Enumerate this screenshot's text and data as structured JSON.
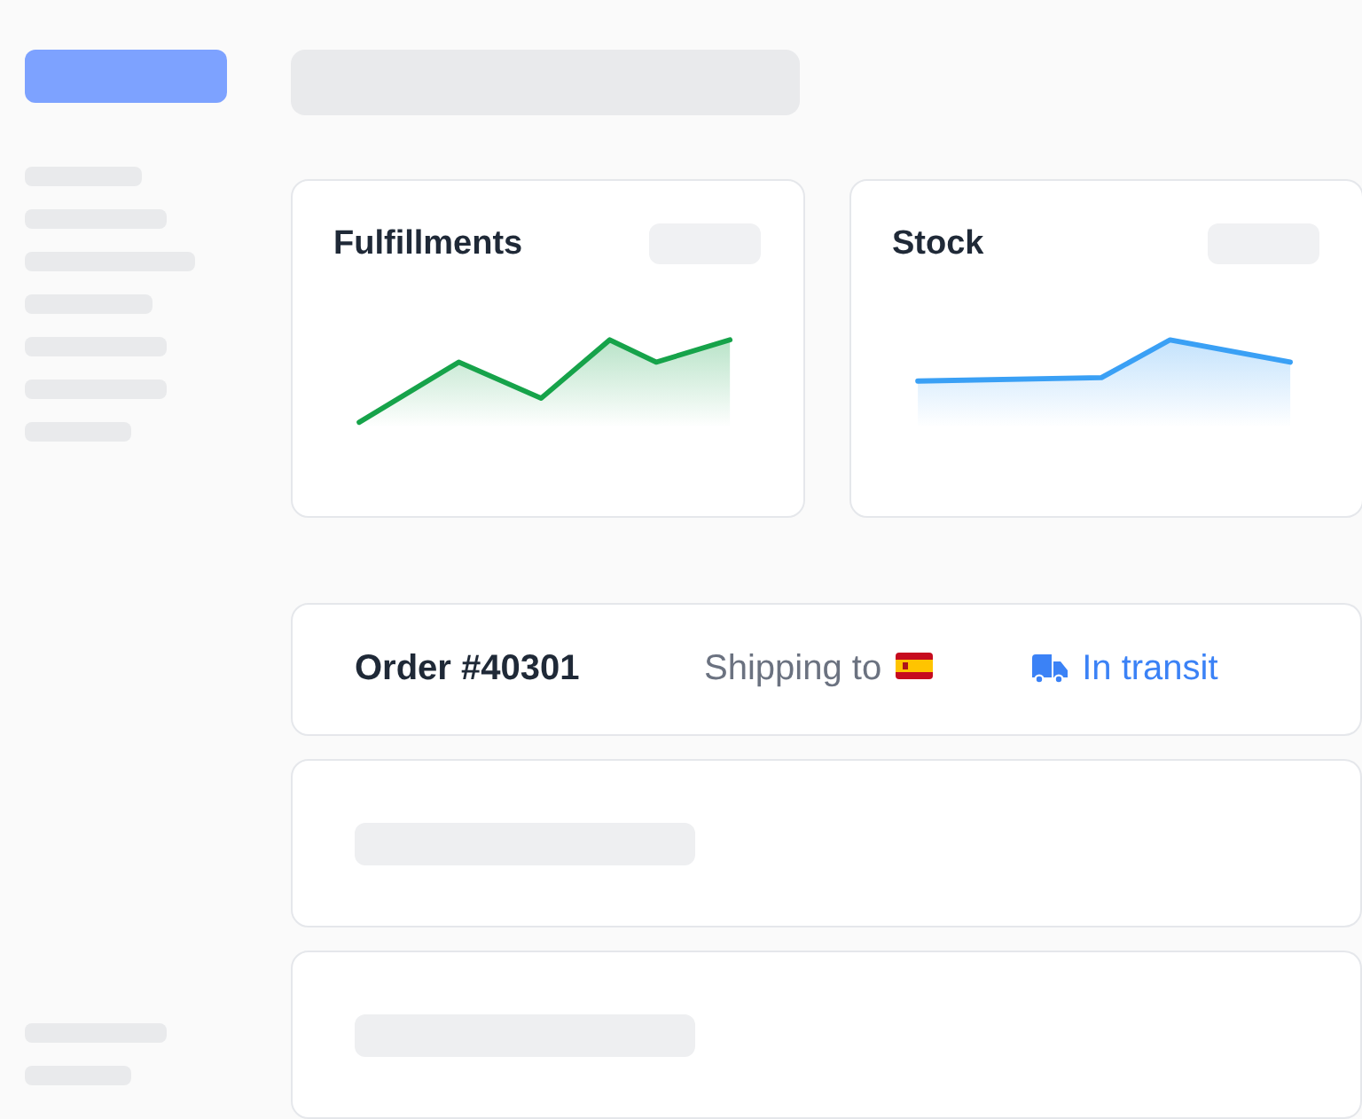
{
  "stat_cards": [
    {
      "title": "Fulfillments",
      "color": "#16a34a"
    },
    {
      "title": "Stock",
      "color": "#3aa0f5"
    }
  ],
  "order": {
    "number": "Order #40301",
    "shipping_label": "Shipping to",
    "status": "In transit"
  }
}
